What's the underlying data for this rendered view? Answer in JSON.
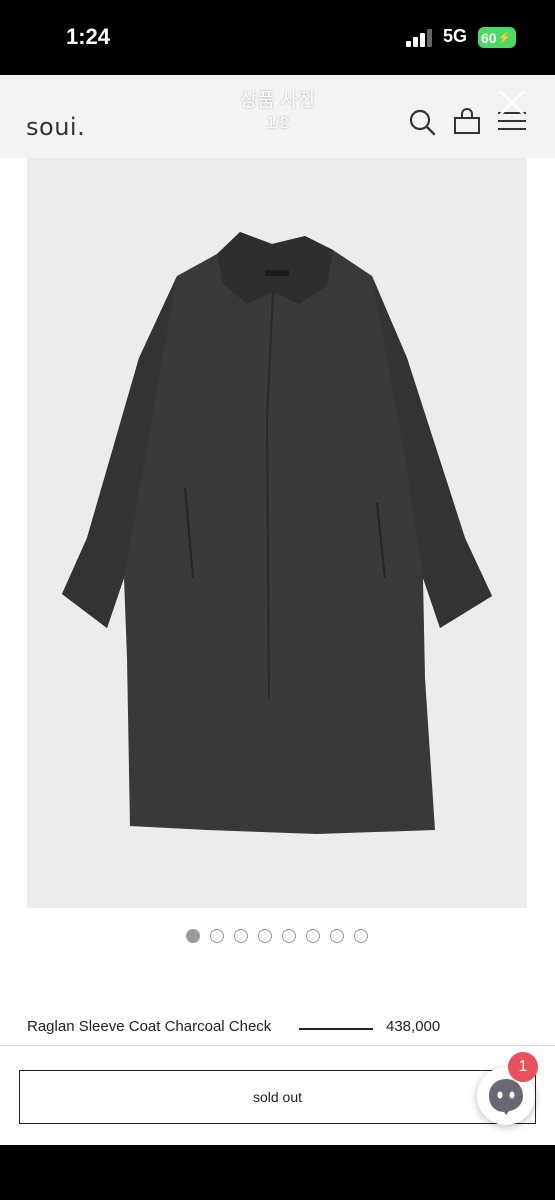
{
  "status_bar": {
    "time": "1:24",
    "network": "5G",
    "battery": "60",
    "battery_color": "#4cd964"
  },
  "header": {
    "logo": "soui.",
    "overlay_title": "상품 사진",
    "overlay_counter": "1/2",
    "icons": [
      "search-icon",
      "bag-icon",
      "menu-icon",
      "close-icon"
    ]
  },
  "product": {
    "image_subject": "coat-image",
    "coat_color": "#3a3838",
    "carousel_total": 8,
    "carousel_active": 0,
    "name": "Raglan Sleeve Coat Charcoal Check",
    "price": "438,000"
  },
  "actions": {
    "soldout_label": "sold out"
  },
  "chat": {
    "badge_count": "1",
    "badge_color": "#e8505b"
  }
}
